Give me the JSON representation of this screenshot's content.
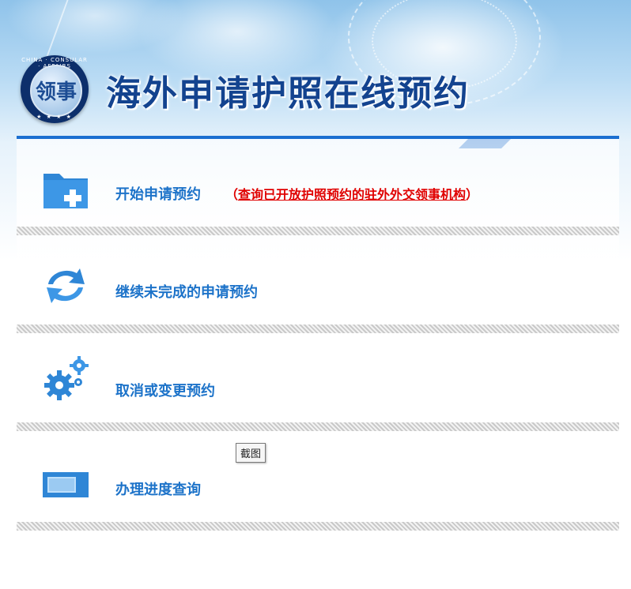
{
  "header": {
    "title": "海外申请护照在线预约",
    "emblem_glyph": "领事",
    "emblem_ring_text": "CHINA · CONSULAR · AFFAIRS",
    "emblem_stars": "★ ★ ★ ★"
  },
  "menu": {
    "items": [
      {
        "label": "开始申请预约",
        "icon": "folder-add-icon"
      },
      {
        "label": "继续未完成的申请预约",
        "icon": "refresh-arrows-icon"
      },
      {
        "label": "取消或变更预约",
        "icon": "gears-icon"
      },
      {
        "label": "办理进度查询",
        "icon": "progress-bar-icon"
      }
    ],
    "first_item_note": {
      "open_paren": "（",
      "text": "查询已开放护照预约的驻外外交领事机构",
      "close_paren": "）"
    }
  },
  "tooltip": {
    "text": "截图"
  },
  "colors": {
    "accent_blue": "#1c6fd0",
    "label_blue": "#1d73c9",
    "title_blue": "#13438f",
    "note_red": "#e00000"
  }
}
